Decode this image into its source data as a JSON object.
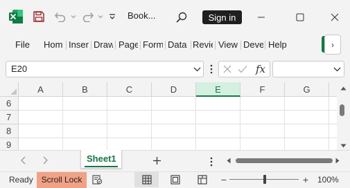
{
  "titlebar": {
    "doc_title": "Book...",
    "signin_label": "Sign in",
    "qat_more_label": "⌄"
  },
  "ribbon": {
    "tabs": [
      "File",
      "Hom",
      "Inser",
      "Draw",
      "Page",
      "Form",
      "Data",
      "Revie",
      "View",
      "Deve",
      "Help"
    ],
    "more_label": "›",
    "accent_color": "#107c41"
  },
  "formula_bar": {
    "name_box_value": "E20",
    "fx_label": "fx",
    "formula_value": ""
  },
  "grid": {
    "columns": [
      "A",
      "B",
      "C",
      "D",
      "E",
      "F",
      "G"
    ],
    "active_column": "E",
    "rows": [
      "6",
      "7",
      "8",
      "9"
    ]
  },
  "sheets": {
    "tabs": [
      "Sheet1"
    ],
    "active": "Sheet1",
    "add_label": "+"
  },
  "status": {
    "ready": "Ready",
    "scroll_lock": "Scroll Lock",
    "scroll_lock_color": "#f2a185",
    "zoom_minus": "−",
    "zoom_plus": "+",
    "zoom_level": "100%",
    "zoom_fraction": 0.5
  },
  "icons": {
    "excel_logo": "excel-logo-icon",
    "save": "save-icon",
    "undo": "undo-icon",
    "redo": "redo-icon",
    "search": "search-icon",
    "minimize": "minimize-icon",
    "maximize": "maximize-icon",
    "close": "close-icon"
  }
}
